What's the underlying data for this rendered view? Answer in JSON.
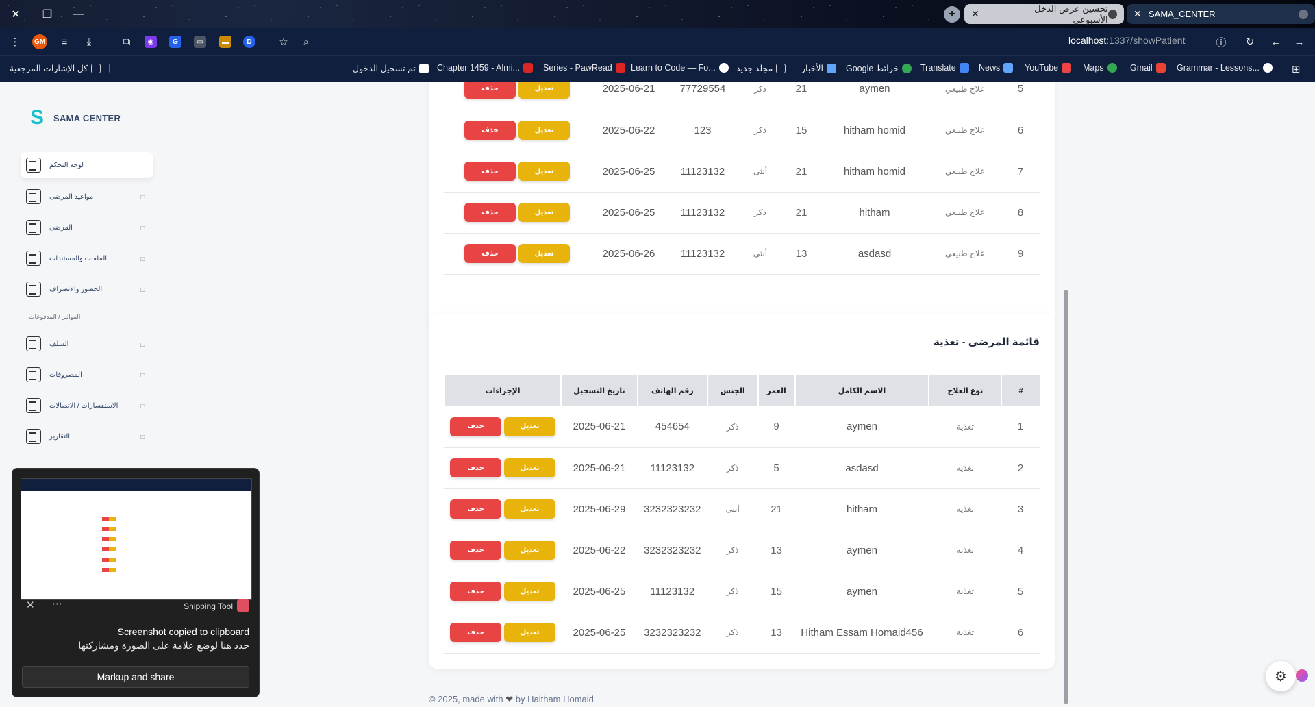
{
  "browser": {
    "tabs": [
      {
        "title": "SAMA_CENTER",
        "active": true
      },
      {
        "title": "تحسين عرض الدخل الأسبوعي",
        "active": false
      }
    ],
    "url_host": "localhost",
    "url_path": ":1337/showPatient",
    "profile": "GM",
    "bookmarks": [
      "كل الإشارات المرجعية",
      "تم تسجيل الدخول",
      "Chapter 1459 - Almi...",
      "Series - PawRead",
      "Learn to Code — Fo...",
      "مجلد جديد",
      "الأخبار",
      "Google خرائط",
      "Translate",
      "News",
      "YouTube",
      "Maps",
      "Gmail",
      "Grammar - Lessons..."
    ]
  },
  "sidebar": {
    "brand": "SAMA CENTER",
    "items": [
      {
        "label": "لوحة التحكم",
        "active": true
      },
      {
        "label": "مواعيد المرضى"
      },
      {
        "label": "المرضى"
      },
      {
        "label": "الملفات والمستندات"
      },
      {
        "label": "الحضور والانصراف"
      },
      {
        "section": "الفواتير / المدفوعات"
      },
      {
        "label": "السلف"
      },
      {
        "label": "المصروفات"
      },
      {
        "label": "الاستفسارات / الاتصالات"
      },
      {
        "label": "التقارير"
      }
    ]
  },
  "buttons": {
    "edit": "تعديل",
    "delete": "حذف"
  },
  "table_top": {
    "rows": [
      {
        "id": "5",
        "type": "علاج طبيعي",
        "name": "aymen",
        "age": "21",
        "gender": "ذكر",
        "phone": "77729554",
        "date": "2025-06-21"
      },
      {
        "id": "6",
        "type": "علاج طبيعي",
        "name": "hitham homid",
        "age": "15",
        "gender": "ذكر",
        "phone": "123",
        "date": "2025-06-22"
      },
      {
        "id": "7",
        "type": "علاج طبيعي",
        "name": "hitham homid",
        "age": "21",
        "gender": "أنثى",
        "phone": "11123132",
        "date": "2025-06-25"
      },
      {
        "id": "8",
        "type": "علاج طبيعي",
        "name": "hitham",
        "age": "21",
        "gender": "ذكر",
        "phone": "11123132",
        "date": "2025-06-25"
      },
      {
        "id": "9",
        "type": "علاج طبيعي",
        "name": "asdasd",
        "age": "13",
        "gender": "أنثى",
        "phone": "11123132",
        "date": "2025-06-26"
      }
    ]
  },
  "table_bottom": {
    "title": "قائمة المرضى - تغذية",
    "headers": [
      "#",
      "نوع العلاج",
      "الاسم الكامل",
      "العمر",
      "الجنس",
      "رقم الهاتف",
      "تاريخ التسجيل",
      "الإجراءات"
    ],
    "rows": [
      {
        "id": "1",
        "type": "تغذية",
        "name": "aymen",
        "age": "9",
        "gender": "ذكر",
        "phone": "454654",
        "date": "2025-06-21"
      },
      {
        "id": "2",
        "type": "تغذية",
        "name": "asdasd",
        "age": "5",
        "gender": "ذكر",
        "phone": "11123132",
        "date": "2025-06-21"
      },
      {
        "id": "3",
        "type": "تغذية",
        "name": "hitham",
        "age": "21",
        "gender": "أنثى",
        "phone": "3232323232",
        "date": "2025-06-29"
      },
      {
        "id": "4",
        "type": "تغذية",
        "name": "aymen",
        "age": "13",
        "gender": "ذكر",
        "phone": "3232323232",
        "date": "2025-06-22"
      },
      {
        "id": "5",
        "type": "تغذية",
        "name": "aymen",
        "age": "15",
        "gender": "ذكر",
        "phone": "11123132",
        "date": "2025-06-25"
      },
      {
        "id": "6",
        "type": "تغذية",
        "name": "Hitham Essam Homaid456",
        "age": "13",
        "gender": "ذكر",
        "phone": "3232323232",
        "date": "2025-06-25"
      }
    ]
  },
  "footer": {
    "text_before": "© 2025, made with",
    "text_after": "by Haitham Homaid"
  },
  "snipping_toast": {
    "app": "Snipping Tool",
    "message": "Screenshot copied to clipboard",
    "sub_message": "حدد هنا لوضع علامة على الصورة ومشاركتها",
    "button": "Markup and share"
  }
}
